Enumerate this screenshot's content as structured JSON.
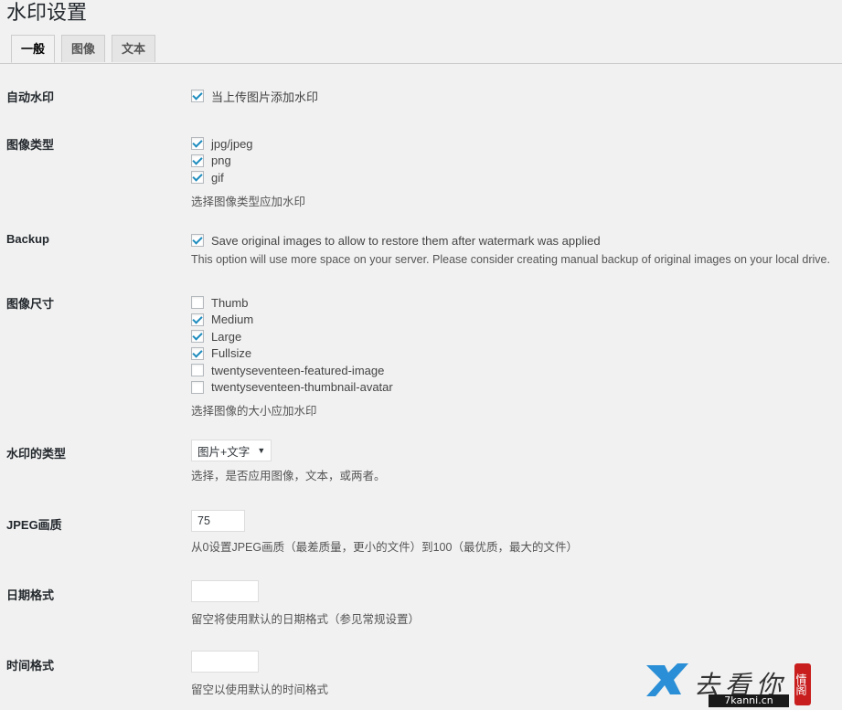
{
  "page": {
    "title": "水印设置"
  },
  "tabs": [
    {
      "label": "一般",
      "active": true
    },
    {
      "label": "图像",
      "active": false
    },
    {
      "label": "文本",
      "active": false
    }
  ],
  "auto_watermark": {
    "label": "自动水印",
    "option": "当上传图片添加水印",
    "checked": true
  },
  "image_types": {
    "label": "图像类型",
    "options": [
      {
        "label": "jpg/jpeg",
        "checked": true
      },
      {
        "label": "png",
        "checked": true
      },
      {
        "label": "gif",
        "checked": true
      }
    ],
    "description": "选择图像类型应加水印"
  },
  "backup": {
    "label": "Backup",
    "option": "Save original images to allow to restore them after watermark was applied",
    "checked": true,
    "description": "This option will use more space on your server. Please consider creating manual backup of original images on your local drive."
  },
  "image_sizes": {
    "label": "图像尺寸",
    "options": [
      {
        "label": "Thumb",
        "checked": false
      },
      {
        "label": "Medium",
        "checked": true
      },
      {
        "label": "Large",
        "checked": true
      },
      {
        "label": "Fullsize",
        "checked": true
      },
      {
        "label": "twentyseventeen-featured-image",
        "checked": false
      },
      {
        "label": "twentyseventeen-thumbnail-avatar",
        "checked": false
      }
    ],
    "description": "选择图像的大小应加水印"
  },
  "watermark_type": {
    "label": "水印的类型",
    "selected": "图片+文字",
    "description": "选择，是否应用图像，文本，或两者。"
  },
  "jpeg_quality": {
    "label": "JPEG画质",
    "value": "75",
    "description": "从0设置JPEG画质（最差质量，更小的文件）到100（最优质，最大的文件）"
  },
  "date_format": {
    "label": "日期格式",
    "value": "",
    "description": "留空将使用默认的日期格式（参见常规设置）"
  },
  "time_format": {
    "label": "时间格式",
    "value": "",
    "description": "留空以使用默认的时间格式"
  },
  "watermark_logo": {
    "brand_text": "去看你",
    "url": "7kanni.cn",
    "stamp_text": "情阁",
    "brand_color": "#2a8fd6",
    "stamp_color": "#c81e1e"
  }
}
